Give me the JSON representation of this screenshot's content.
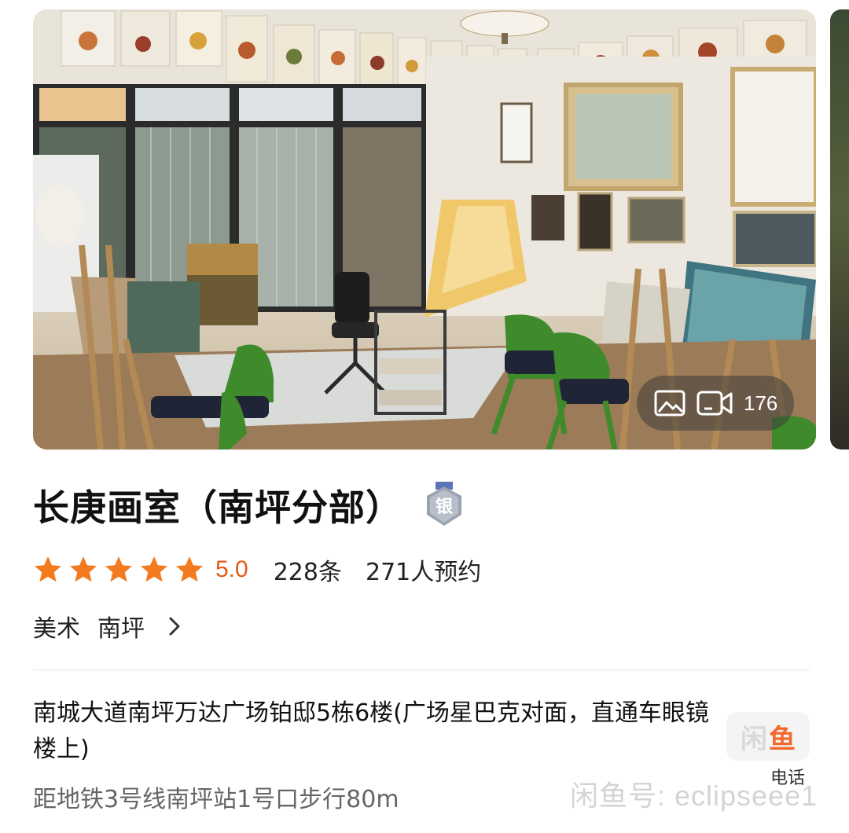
{
  "gallery": {
    "media_count": "176",
    "photo_icon": "image-icon",
    "video_icon": "video-camera-icon"
  },
  "shop": {
    "name": "长庚画室（南坪分部）",
    "badge": "银",
    "badge_icon": "silver-medal-icon"
  },
  "rating": {
    "stars": 5,
    "score": "5.0",
    "reviews": "228条",
    "bookings": "271人预约",
    "star_color": "#f27a1f",
    "score_color": "#e45a1a"
  },
  "category": {
    "type": "美术",
    "area": "南坪",
    "chevron_icon": "chevron-right-icon"
  },
  "location": {
    "address": "南城大道南坪万达广场铂邸5栋6楼(广场星巴克对面，直通车眼镜楼上)",
    "distance": "距地铁3号线南坪站1号口步行80m"
  },
  "phone": {
    "logo_left": "闲",
    "logo_right": "鱼",
    "label": "电话"
  },
  "watermark": "闲鱼号: eclipseee1"
}
